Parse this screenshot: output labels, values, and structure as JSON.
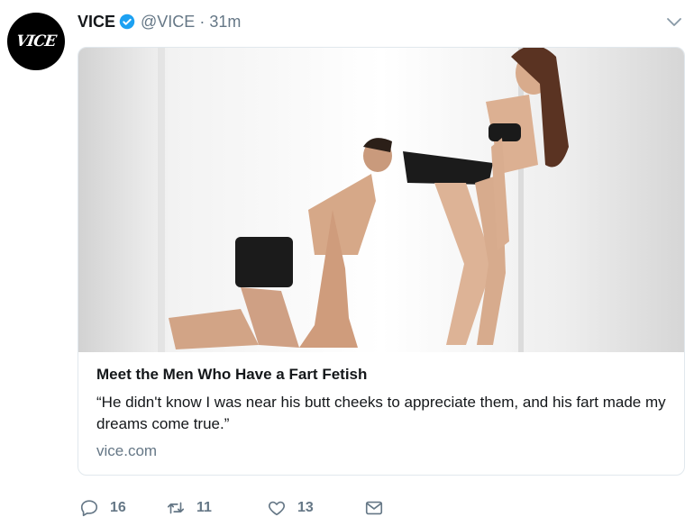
{
  "tweet": {
    "author_name": "VICE",
    "handle": "@VICE",
    "separator": "·",
    "time": "31m",
    "avatar_text": "VICE"
  },
  "card": {
    "title": "Meet the Men Who Have a Fart Fetish",
    "description": "“He didn't know I was near his butt cheeks to appreciate them, and his fart made my dreams come true.”",
    "domain": "vice.com"
  },
  "actions": {
    "replies": "16",
    "retweets": "11",
    "likes": "13"
  },
  "icons": [
    "verified-badge-icon",
    "chevron-down-icon",
    "reply-icon",
    "retweet-icon",
    "like-icon",
    "message-icon"
  ],
  "colors": {
    "accent": "#1da1f2",
    "muted": "#657786",
    "text": "#14171a",
    "border": "#e1e8ed"
  }
}
